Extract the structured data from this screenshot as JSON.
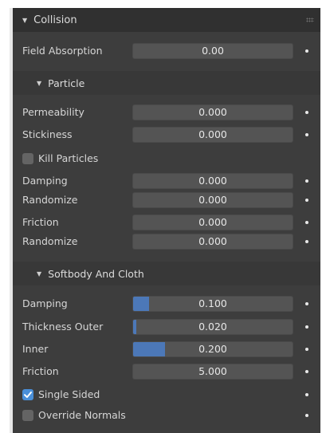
{
  "collision": {
    "title": "Collision",
    "field_absorption": {
      "label": "Field Absorption",
      "value": "0.00"
    }
  },
  "particle": {
    "title": "Particle",
    "permeability": {
      "label": "Permeability",
      "value": "0.000"
    },
    "stickiness": {
      "label": "Stickiness",
      "value": "0.000"
    },
    "kill_particles": {
      "label": "Kill Particles",
      "checked": false
    },
    "damping": {
      "label": "Damping",
      "value": "0.000"
    },
    "damping_randomize": {
      "label": "Randomize",
      "value": "0.000"
    },
    "friction": {
      "label": "Friction",
      "value": "0.000"
    },
    "friction_randomize": {
      "label": "Randomize",
      "value": "0.000"
    }
  },
  "softbody_cloth": {
    "title": "Softbody And Cloth",
    "damping": {
      "label": "Damping",
      "value": "0.100",
      "fill_fraction": 0.1
    },
    "thickness_outer": {
      "label": "Thickness Outer",
      "value": "0.020",
      "fill_fraction": 0.02
    },
    "inner": {
      "label": "Inner",
      "value": "0.200",
      "fill_fraction": 0.2
    },
    "friction": {
      "label": "Friction",
      "value": "5.000"
    },
    "single_sided": {
      "label": "Single Sided",
      "checked": true
    },
    "override_normals": {
      "label": "Override Normals",
      "checked": false
    }
  },
  "colors": {
    "panel_bg": "#3d3d3d",
    "header_bg": "#303030",
    "field_bg": "#545454",
    "slider_fill": "#4c78b8",
    "checkbox_on": "#4a8fd8"
  }
}
